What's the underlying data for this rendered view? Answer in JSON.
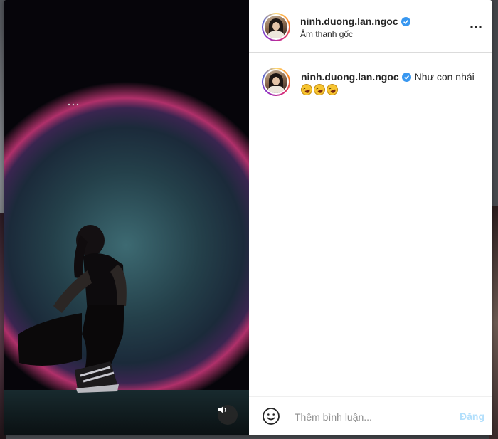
{
  "post": {
    "author": "ninh.duong.lan.ngoc",
    "audio": "Âm thanh gốc",
    "verified": true
  },
  "caption": {
    "author": "ninh.duong.lan.ngoc",
    "text": "Như con nhái",
    "emoji_count": 3,
    "emoji": "rolling-on-floor-laughing-icon"
  },
  "composer": {
    "placeholder": "Thêm bình luận...",
    "post_label": "Đăng"
  },
  "colors": {
    "verified": "#3897f0",
    "post_disabled": "#b2dffc",
    "text": "#262626",
    "muted": "#8e8e8e"
  }
}
